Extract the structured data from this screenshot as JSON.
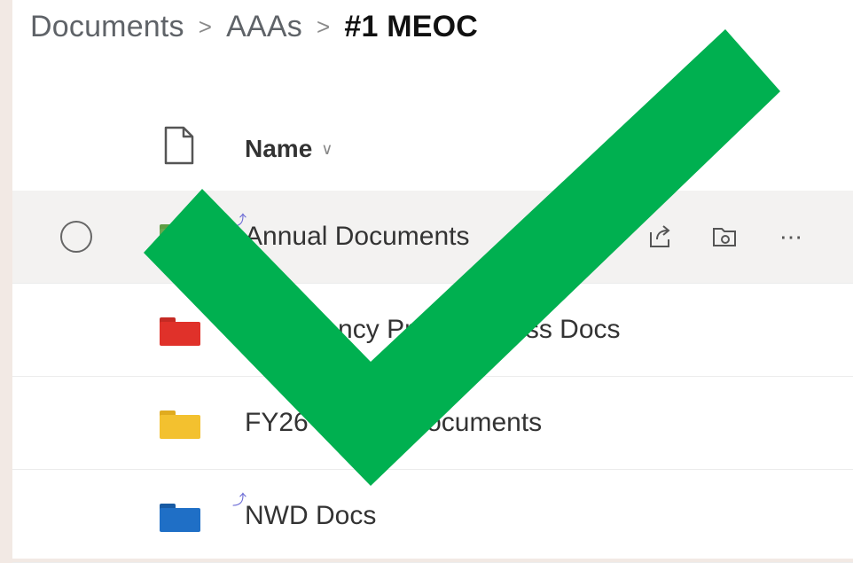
{
  "breadcrumb": {
    "items": [
      "Documents",
      "AAAs"
    ],
    "current": "#1 MEOC",
    "separator": ">"
  },
  "list_header": {
    "name_label": "Name",
    "sort_icon": "chevron-down-icon"
  },
  "rows": [
    {
      "label": "Annual Documents",
      "folder_color": "#6aa84f",
      "synced": true,
      "selected": true
    },
    {
      "label": "Emergency Preparedness Docs",
      "folder_color": "#e0312a",
      "synced": false,
      "selected": false
    },
    {
      "label": "FY26 Budget Documents",
      "folder_color": "#f3c12f",
      "synced": false,
      "selected": false
    },
    {
      "label": "NWD Docs",
      "folder_color": "#1f6fc6",
      "synced": true,
      "selected": false
    }
  ],
  "row_actions": [
    "share-icon",
    "move-to-folder-icon",
    "more-options-icon"
  ],
  "overlay": {
    "icon": "checkmark-icon",
    "color": "#00b050"
  },
  "colors": {
    "background": "#f2e9e4",
    "selected_row": "#f3f2f1"
  }
}
